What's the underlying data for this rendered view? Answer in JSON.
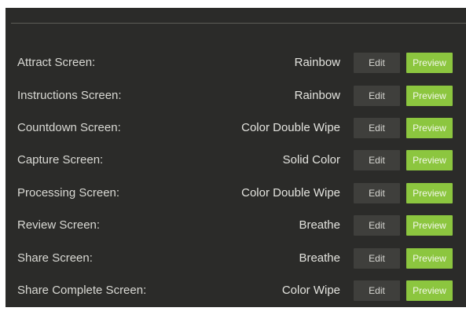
{
  "settings": {
    "rows": [
      {
        "label": "Attract Screen:",
        "value": "Rainbow",
        "edit": "Edit",
        "preview": "Preview"
      },
      {
        "label": "Instructions Screen:",
        "value": "Rainbow",
        "edit": "Edit",
        "preview": "Preview"
      },
      {
        "label": "Countdown Screen:",
        "value": "Color Double Wipe",
        "edit": "Edit",
        "preview": "Preview"
      },
      {
        "label": "Capture Screen:",
        "value": "Solid Color",
        "edit": "Edit",
        "preview": "Preview"
      },
      {
        "label": "Processing Screen:",
        "value": "Color Double Wipe",
        "edit": "Edit",
        "preview": "Preview"
      },
      {
        "label": "Review Screen:",
        "value": "Breathe",
        "edit": "Edit",
        "preview": "Preview"
      },
      {
        "label": "Share Screen:",
        "value": "Breathe",
        "edit": "Edit",
        "preview": "Preview"
      },
      {
        "label": "Share Complete Screen:",
        "value": "Color Wipe",
        "edit": "Edit",
        "preview": "Preview"
      }
    ]
  },
  "colors": {
    "panel_background": "#2b2b29",
    "edit_button": "#3f3f3c",
    "preview_button": "#8cc63f"
  }
}
